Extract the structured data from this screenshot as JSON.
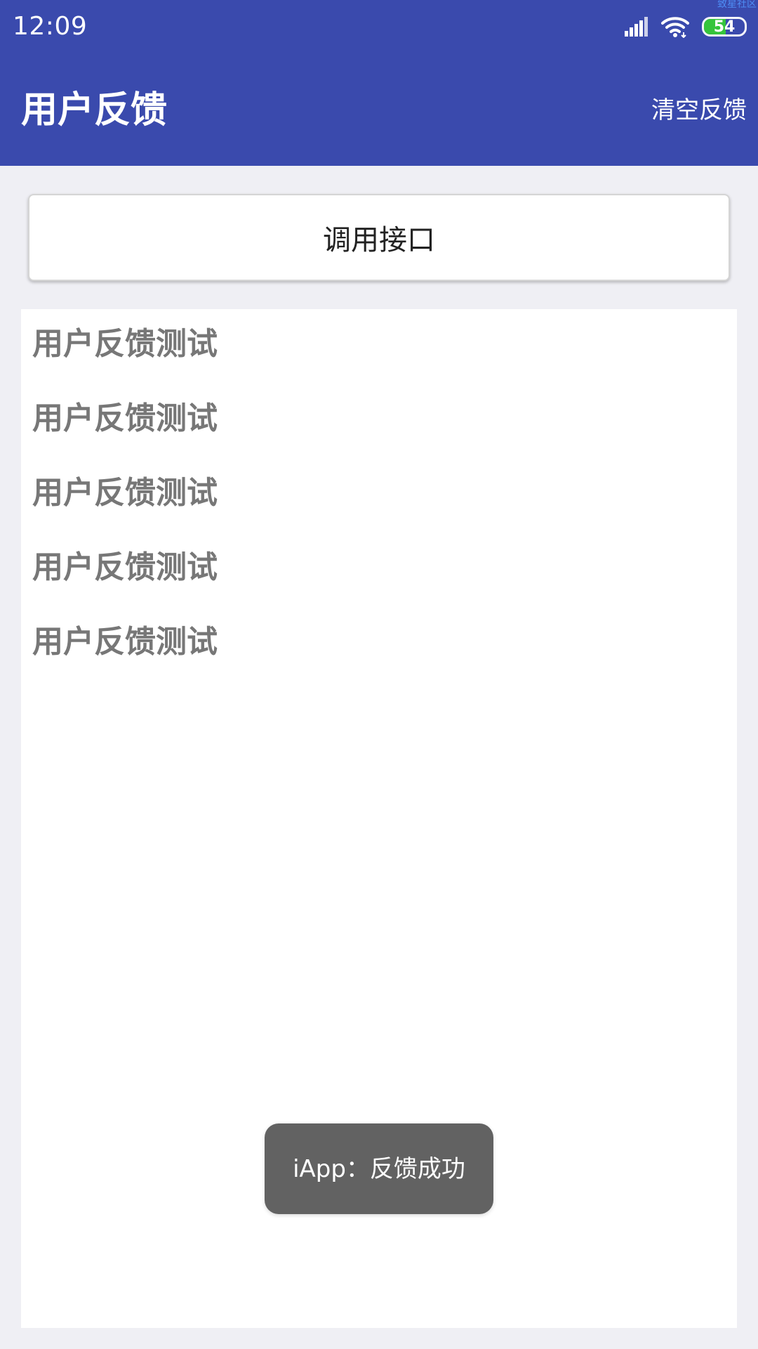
{
  "status_bar": {
    "time": "12:09",
    "battery_level": "54",
    "battery_percent": 54,
    "watermark": "致星社区",
    "icons": {
      "signal": "signal-icon",
      "wifi": "wifi-icon",
      "battery": "battery-icon"
    }
  },
  "app_bar": {
    "title": "用户反馈",
    "clear_feedback_label": "清空反馈"
  },
  "actions": {
    "call_api_label": "调用接口"
  },
  "feedback_list": {
    "items": [
      "用户反馈测试",
      "用户反馈测试",
      "用户反馈测试",
      "用户反馈测试",
      "用户反馈测试"
    ]
  },
  "toast": {
    "text": "iApp：反馈成功"
  },
  "colors": {
    "primary": "#3a4aad",
    "page_background": "#efeff4",
    "list_background": "#ffffff",
    "feedback_text": "#777777",
    "toast_background": "#626262",
    "battery_fill": "#35c43b"
  }
}
